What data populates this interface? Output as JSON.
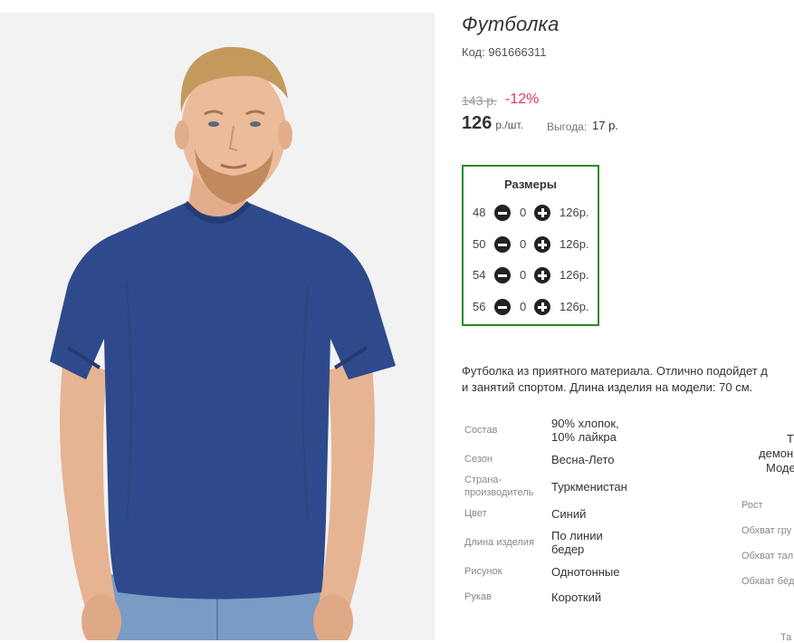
{
  "product": {
    "title": "Футболка",
    "code_label": "Код: 961666311",
    "old_price": "143 р.",
    "discount": "-12%",
    "price": "126",
    "price_unit": "р./шт.",
    "benefit_label": "Выгода:",
    "benefit_value": "17 р.",
    "image_icon": "product-photo-tshirt-model"
  },
  "sizes": {
    "title": "Размеры",
    "rows": [
      {
        "size": "48",
        "qty": "0",
        "price": "126р."
      },
      {
        "size": "50",
        "qty": "0",
        "price": "126р."
      },
      {
        "size": "54",
        "qty": "0",
        "price": "126р."
      },
      {
        "size": "56",
        "qty": "0",
        "price": "126р."
      }
    ],
    "minus_icon": "minus-circle-icon",
    "plus_icon": "plus-circle-icon"
  },
  "description": {
    "line1": "Футболка из приятного материала. Отлично подойдет д",
    "line2": "и занятий спортом. Длина изделия на модели: 70 см."
  },
  "specs": [
    {
      "label": "Состав",
      "value_lines": [
        "90% хлопок,",
        "10% лайкра"
      ]
    },
    {
      "label": "Сезон",
      "value_lines": [
        "Весна-Лето"
      ]
    },
    {
      "label_lines": [
        "Страна-",
        "производитель"
      ],
      "value_lines": [
        "Туркменистан"
      ]
    },
    {
      "label": "Цвет",
      "value_lines": [
        "Синий"
      ]
    },
    {
      "label": "Длина изделия",
      "value_lines": [
        "По линии",
        "бедер"
      ]
    },
    {
      "label": "Рисунок",
      "value_lines": [
        "Однотонные"
      ]
    },
    {
      "label": "Рукав",
      "value_lines": [
        "Короткий"
      ]
    }
  ],
  "right_column": {
    "heading_lines": [
      "Т",
      "демон",
      "Моде"
    ],
    "rows": [
      "Рост",
      "Обхват гру",
      "Обхват тал",
      "Обхват бёд"
    ],
    "bottom": "Та"
  },
  "colors": {
    "accent_green": "#2a8a2a",
    "discount_red": "#e0345a",
    "shirt_blue": "#2e4a8c"
  }
}
